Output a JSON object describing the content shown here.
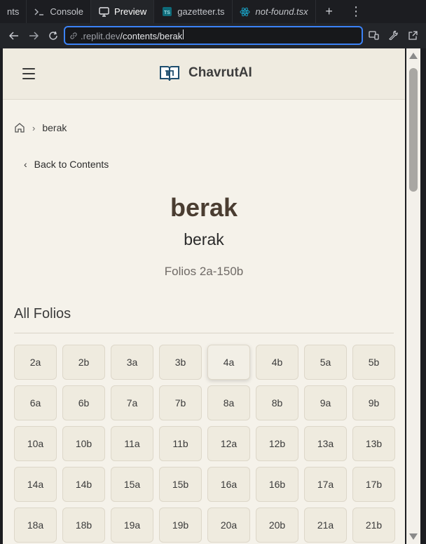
{
  "tabs": [
    {
      "label": "nts",
      "icon": "none",
      "italic": false
    },
    {
      "label": "Console",
      "icon": "terminal-icon",
      "italic": false
    },
    {
      "label": "Preview",
      "icon": "monitor-icon",
      "italic": false,
      "active": true
    },
    {
      "label": "gazetteer.ts",
      "icon": "typescript-icon",
      "italic": false
    },
    {
      "label": "not-found.tsx",
      "icon": "react-icon",
      "italic": true
    }
  ],
  "address": {
    "prefix": ".replit.dev",
    "path": "/contents/berak"
  },
  "header": {
    "brand": "ChavrutAI"
  },
  "breadcrumb": {
    "current": "berak"
  },
  "back_label": "Back to Contents",
  "tractate": {
    "title": "berak",
    "subtitle": "berak",
    "folio_range": "Folios 2a-150b"
  },
  "section": {
    "title": "All Folios"
  },
  "folios": [
    "2a",
    "2b",
    "3a",
    "3b",
    "4a",
    "4b",
    "5a",
    "5b",
    "6a",
    "6b",
    "7a",
    "7b",
    "8a",
    "8b",
    "9a",
    "9b",
    "10a",
    "10b",
    "11a",
    "11b",
    "12a",
    "12b",
    "13a",
    "13b",
    "14a",
    "14b",
    "15a",
    "15b",
    "16a",
    "16b",
    "17a",
    "17b",
    "18a",
    "18b",
    "19a",
    "19b",
    "20a",
    "20b",
    "21a",
    "21b"
  ],
  "colors": {
    "accent": "#3b82f6",
    "page_bg": "#f5f2ea",
    "title": "#4a3d31"
  }
}
